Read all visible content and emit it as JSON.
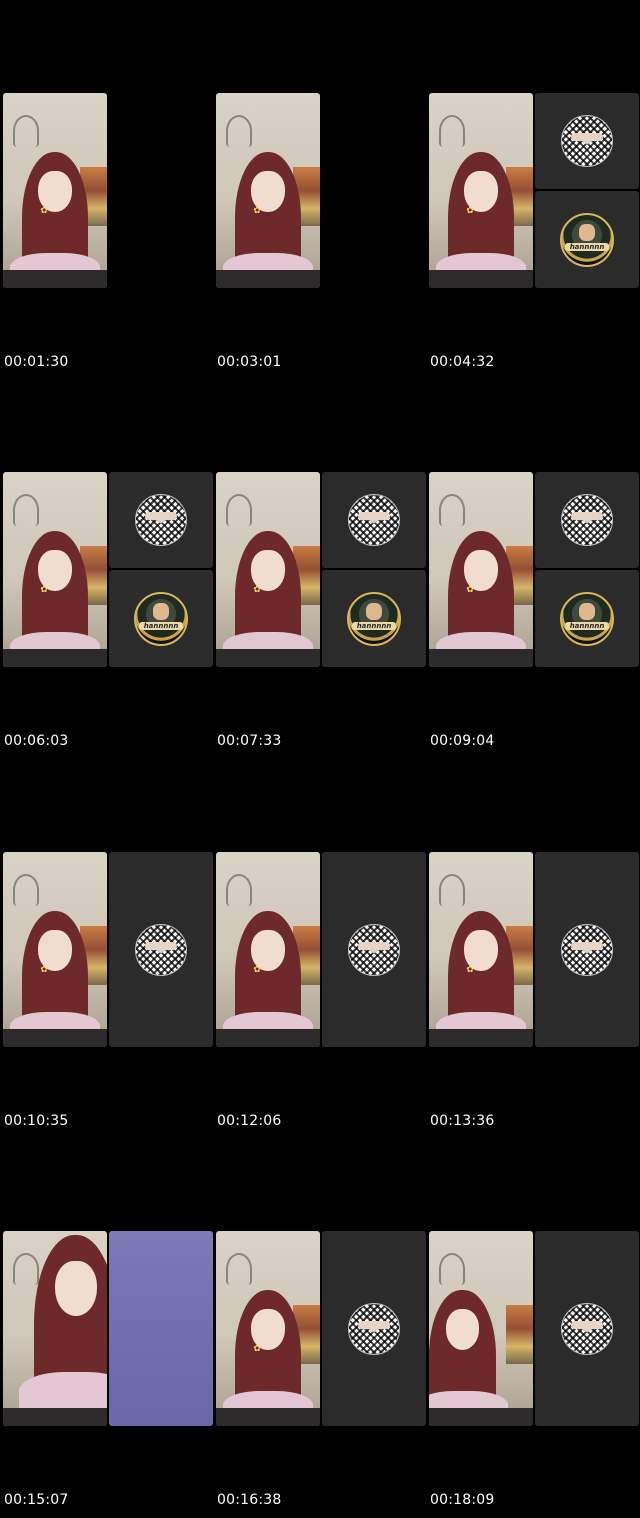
{
  "thumbnails": [
    {
      "timestamp": "00:01:30",
      "layout": "single"
    },
    {
      "timestamp": "00:03:01",
      "layout": "single"
    },
    {
      "timestamp": "00:04:32",
      "layout": "split",
      "avatars": [
        "keffiyeh-avatar",
        "logo-avatar"
      ]
    },
    {
      "timestamp": "00:06:03",
      "layout": "split",
      "avatars": [
        "keffiyeh-avatar",
        "logo-avatar"
      ]
    },
    {
      "timestamp": "00:07:33",
      "layout": "split",
      "avatars": [
        "keffiyeh-avatar",
        "logo-avatar"
      ]
    },
    {
      "timestamp": "00:09:04",
      "layout": "split",
      "avatars": [
        "keffiyeh-avatar",
        "logo-avatar"
      ]
    },
    {
      "timestamp": "00:10:35",
      "layout": "side",
      "avatars": [
        "keffiyeh-avatar"
      ]
    },
    {
      "timestamp": "00:12:06",
      "layout": "side",
      "avatars": [
        "keffiyeh-avatar"
      ]
    },
    {
      "timestamp": "00:13:36",
      "layout": "side",
      "avatars": [
        "keffiyeh-avatar"
      ]
    },
    {
      "timestamp": "00:15:07",
      "layout": "lilac",
      "avatars": []
    },
    {
      "timestamp": "00:16:38",
      "layout": "side",
      "avatars": [
        "keffiyeh-avatar"
      ]
    },
    {
      "timestamp": "00:18:09",
      "layout": "side",
      "avatars": [
        "keffiyeh-avatar"
      ]
    }
  ],
  "logo_avatar_text": "hannnnn",
  "colors": {
    "background": "#000000",
    "tile": "#2b2b2b",
    "hijab": "#6e2a2a",
    "lilac": "#7e7ab8"
  }
}
